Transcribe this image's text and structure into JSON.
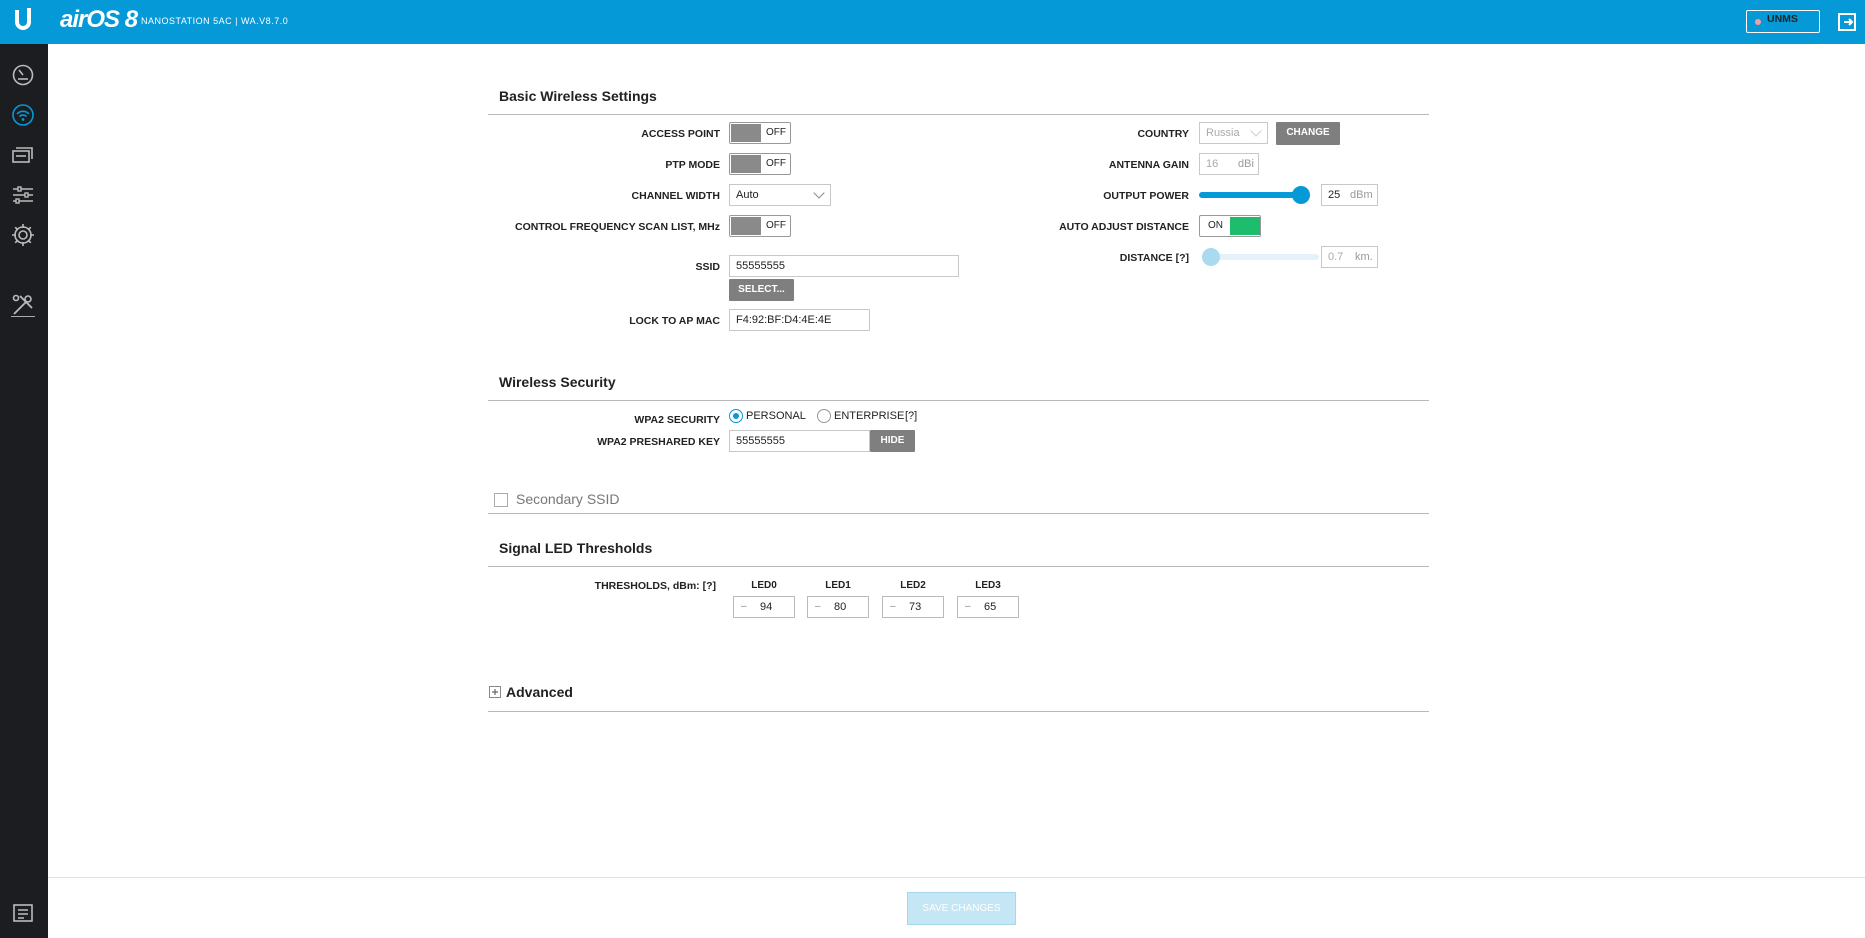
{
  "header": {
    "brand": "airOS 8",
    "device": "NANOSTATION 5AC | WA.V8.7.0",
    "unms_label": "UNMS"
  },
  "sidebar": {
    "items": [
      {
        "name": "dashboard",
        "icon": "gauge-icon"
      },
      {
        "name": "wireless",
        "icon": "wifi-icon",
        "active": true
      },
      {
        "name": "network",
        "icon": "network-icon"
      },
      {
        "name": "services",
        "icon": "sliders-icon"
      },
      {
        "name": "system",
        "icon": "gear-icon"
      },
      {
        "name": "tools",
        "icon": "tools-icon"
      },
      {
        "name": "log",
        "icon": "log-icon"
      }
    ]
  },
  "basic": {
    "title": "Basic Wireless Settings",
    "access_point_label": "ACCESS POINT",
    "access_point_state": "OFF",
    "ptp_label": "PTP MODE",
    "ptp_state": "OFF",
    "channel_width_label": "CHANNEL WIDTH",
    "channel_width_value": "Auto",
    "scan_list_label": "CONTROL FREQUENCY SCAN LIST, MHz",
    "scan_list_state": "OFF",
    "ssid_label": "SSID",
    "ssid_value": "55555555",
    "select_button": "SELECT...",
    "lock_mac_label": "LOCK TO AP MAC",
    "lock_mac_value": "F4:92:BF:D4:4E:4E",
    "country_label": "COUNTRY",
    "country_value": "Russia",
    "change_button": "CHANGE",
    "antenna_gain_label": "ANTENNA GAIN",
    "antenna_gain_value": "16",
    "antenna_gain_unit": "dBi",
    "output_power_label": "OUTPUT POWER",
    "output_power_value": "25",
    "output_power_unit": "dBm",
    "output_power_level": 0.93,
    "auto_distance_label": "AUTO ADJUST DISTANCE",
    "auto_distance_state": "ON",
    "distance_label": "DISTANCE [?]",
    "distance_value": "0.7",
    "distance_unit": "km.",
    "distance_level": 0.0
  },
  "security": {
    "title": "Wireless Security",
    "wpa2_label": "WPA2 SECURITY",
    "personal_label": "PERSONAL",
    "enterprise_label": "ENTERPRISE",
    "help": "[?]",
    "psk_label": "WPA2 PRESHARED KEY",
    "psk_value": "55555555",
    "hide_button": "HIDE"
  },
  "secondary": {
    "title": "Secondary SSID"
  },
  "led": {
    "title": "Signal LED Thresholds",
    "thresholds_label": "THRESHOLDS, dBm: [?]",
    "items": [
      {
        "name": "LED0",
        "value": "94"
      },
      {
        "name": "LED1",
        "value": "80"
      },
      {
        "name": "LED2",
        "value": "73"
      },
      {
        "name": "LED3",
        "value": "65"
      }
    ],
    "minus": "–"
  },
  "advanced": {
    "title": "Advanced"
  },
  "footer": {
    "save_label": "SAVE CHANGES"
  },
  "colors": {
    "header_bg": "#0599d8",
    "sidebar_bg": "#1b1d21",
    "toggle_on": "#1ebd6d",
    "slider_active": "#0599d8"
  }
}
